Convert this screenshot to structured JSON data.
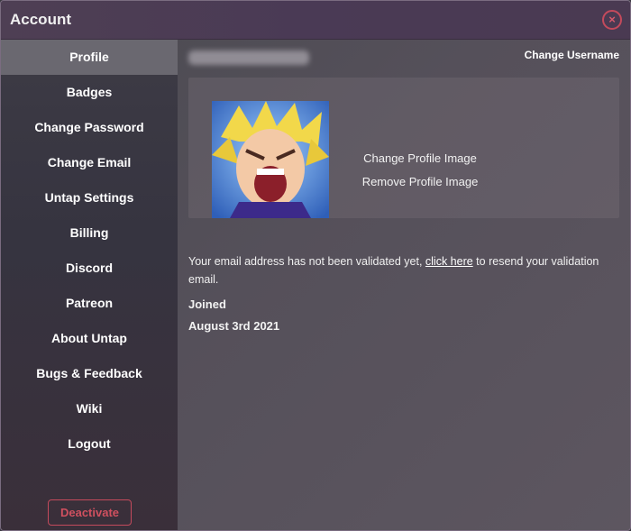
{
  "window": {
    "title": "Account",
    "close_icon": "×"
  },
  "sidebar": {
    "items": [
      {
        "label": "Profile",
        "active": true
      },
      {
        "label": "Badges"
      },
      {
        "label": "Change Password"
      },
      {
        "label": "Change Email"
      },
      {
        "label": "Untap Settings"
      },
      {
        "label": "Billing"
      },
      {
        "label": "Discord"
      },
      {
        "label": "Patreon"
      },
      {
        "label": "About Untap"
      },
      {
        "label": "Bugs & Feedback"
      },
      {
        "label": "Wiki"
      },
      {
        "label": "Logout"
      }
    ],
    "deactivate_label": "Deactivate"
  },
  "profile": {
    "change_username_label": "Change Username",
    "change_image_label": "Change Profile Image",
    "remove_image_label": "Remove Profile Image",
    "notice_before": "Your email address has not been validated yet, ",
    "notice_link": "click here",
    "notice_after": " to resend your validation email.",
    "joined_label": "Joined",
    "joined_date": "August 3rd 2021"
  },
  "colors": {
    "accent_red": "#c44a5c",
    "active_item": "#6a6870"
  }
}
